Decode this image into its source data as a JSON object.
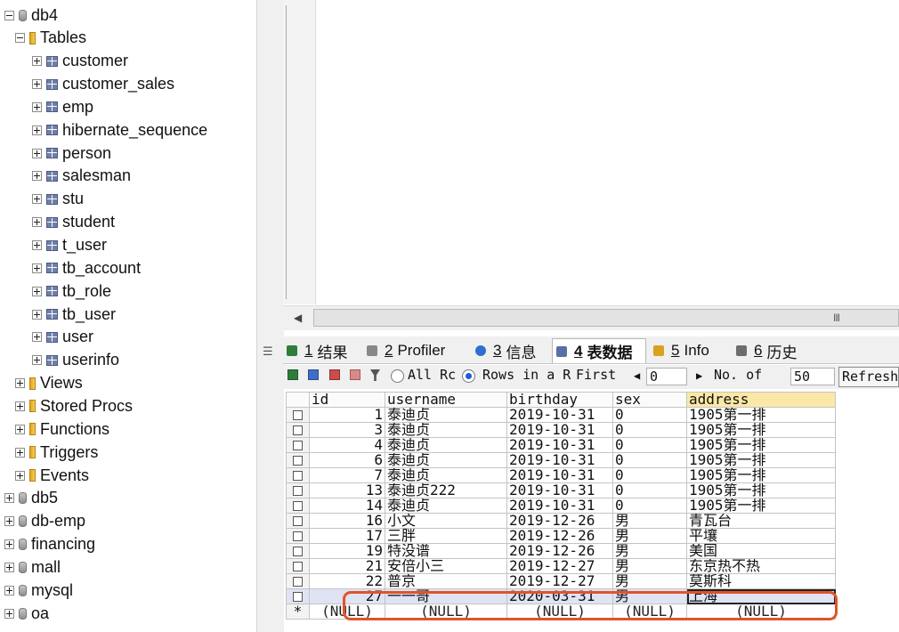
{
  "tree": {
    "nodes": [
      {
        "label": "db4",
        "type": "db",
        "indent": 0,
        "exp": "minus"
      },
      {
        "label": "Tables",
        "type": "folder",
        "indent": 1,
        "exp": "minus"
      },
      {
        "label": "customer",
        "type": "table",
        "indent": 2,
        "exp": "plus"
      },
      {
        "label": "customer_sales",
        "type": "table",
        "indent": 2,
        "exp": "plus"
      },
      {
        "label": "emp",
        "type": "table",
        "indent": 2,
        "exp": "plus"
      },
      {
        "label": "hibernate_sequence",
        "type": "table",
        "indent": 2,
        "exp": "plus"
      },
      {
        "label": "person",
        "type": "table",
        "indent": 2,
        "exp": "plus"
      },
      {
        "label": "salesman",
        "type": "table",
        "indent": 2,
        "exp": "plus"
      },
      {
        "label": "stu",
        "type": "table",
        "indent": 2,
        "exp": "plus"
      },
      {
        "label": "student",
        "type": "table",
        "indent": 2,
        "exp": "plus"
      },
      {
        "label": "t_user",
        "type": "table",
        "indent": 2,
        "exp": "plus"
      },
      {
        "label": "tb_account",
        "type": "table",
        "indent": 2,
        "exp": "plus"
      },
      {
        "label": "tb_role",
        "type": "table",
        "indent": 2,
        "exp": "plus"
      },
      {
        "label": "tb_user",
        "type": "table",
        "indent": 2,
        "exp": "plus"
      },
      {
        "label": "user",
        "type": "table",
        "indent": 2,
        "exp": "plus"
      },
      {
        "label": "userinfo",
        "type": "table",
        "indent": 2,
        "exp": "plus"
      },
      {
        "label": "Views",
        "type": "folder",
        "indent": 1,
        "exp": "plus"
      },
      {
        "label": "Stored Procs",
        "type": "folder",
        "indent": 1,
        "exp": "plus"
      },
      {
        "label": "Functions",
        "type": "folder",
        "indent": 1,
        "exp": "plus"
      },
      {
        "label": "Triggers",
        "type": "folder",
        "indent": 1,
        "exp": "plus"
      },
      {
        "label": "Events",
        "type": "folder",
        "indent": 1,
        "exp": "plus"
      },
      {
        "label": "db5",
        "type": "db",
        "indent": 0,
        "exp": "plus"
      },
      {
        "label": "db-emp",
        "type": "db",
        "indent": 0,
        "exp": "plus"
      },
      {
        "label": "financing",
        "type": "db",
        "indent": 0,
        "exp": "plus"
      },
      {
        "label": "mall",
        "type": "db",
        "indent": 0,
        "exp": "plus"
      },
      {
        "label": "mysql",
        "type": "db",
        "indent": 0,
        "exp": "plus"
      },
      {
        "label": "oa",
        "type": "db",
        "indent": 0,
        "exp": "plus"
      }
    ]
  },
  "splitter": {
    "grip": "☰"
  },
  "scrollbar": {
    "left_arrow": "◀",
    "grip": "III"
  },
  "tabs": [
    {
      "num": "1",
      "label": "结果",
      "icon": "grid-icon"
    },
    {
      "num": "2",
      "label": "Profiler",
      "icon": "profiler-icon"
    },
    {
      "num": "3",
      "label": "信息",
      "icon": "info-icon"
    },
    {
      "num": "4",
      "label": "表数据",
      "icon": "table-data-icon",
      "active": true
    },
    {
      "num": "5",
      "label": "Info",
      "icon": "info-table-icon"
    },
    {
      "num": "6",
      "label": "历史",
      "icon": "history-icon"
    }
  ],
  "toolbar": {
    "all_rows": "All Rc",
    "rows_in_range": "Rows in a R",
    "first": "First",
    "first_value": "0",
    "no_of": "No. of",
    "no_of_value": "50",
    "refresh": "Refresh"
  },
  "grid": {
    "columns": [
      "id",
      "username",
      "birthday",
      "sex",
      "address"
    ],
    "rows": [
      [
        "1",
        "泰迪贞",
        "2019-10-31",
        "0",
        "1905第一排"
      ],
      [
        "3",
        "泰迪贞",
        "2019-10-31",
        "0",
        "1905第一排"
      ],
      [
        "4",
        "泰迪贞",
        "2019-10-31",
        "0",
        "1905第一排"
      ],
      [
        "6",
        "泰迪贞",
        "2019-10-31",
        "0",
        "1905第一排"
      ],
      [
        "7",
        "泰迪贞",
        "2019-10-31",
        "0",
        "1905第一排"
      ],
      [
        "13",
        "泰迪贞222",
        "2019-10-31",
        "0",
        "1905第一排"
      ],
      [
        "14",
        "泰迪贞",
        "2019-10-31",
        "0",
        "1905第一排"
      ],
      [
        "16",
        "小文",
        "2019-12-26",
        "男",
        "青瓦台"
      ],
      [
        "17",
        "三胖",
        "2019-12-26",
        "男",
        "平壤"
      ],
      [
        "19",
        "特没谱",
        "2019-12-26",
        "男",
        "美国"
      ],
      [
        "21",
        "安倍小三",
        "2019-12-27",
        "男",
        "东京热不热"
      ],
      [
        "22",
        "普京",
        "2019-12-27",
        "男",
        "莫斯科"
      ],
      [
        "27",
        "一一哥",
        "2020-03-31",
        "男",
        "上海"
      ]
    ],
    "new_row": [
      "(NULL)",
      "(NULL)",
      "(NULL)",
      "(NULL)",
      "(NULL)"
    ],
    "new_row_marker": "*",
    "highlight_color": "#e0532a"
  }
}
